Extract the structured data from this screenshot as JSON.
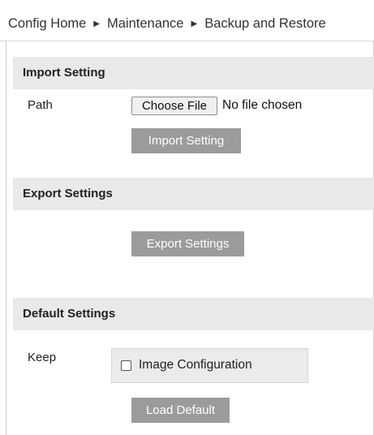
{
  "breadcrumb": {
    "items": [
      "Config Home",
      "Maintenance",
      "Backup and Restore"
    ],
    "separator": "▶"
  },
  "import_section": {
    "title": "Import Setting",
    "path_label": "Path",
    "choose_file_label": "Choose File",
    "file_status": "No file chosen",
    "import_button": "Import Setting"
  },
  "export_section": {
    "title": "Export Settings",
    "export_button": "Export Settings"
  },
  "default_section": {
    "title": "Default Settings",
    "keep_label": "Keep",
    "image_config_label": "Image Configuration",
    "image_config_checked": false,
    "load_default_button": "Load Default"
  },
  "colors": {
    "header_bg": "#e9e9e9",
    "button_bg": "#9b9b9b",
    "button_text": "#ffffff"
  }
}
